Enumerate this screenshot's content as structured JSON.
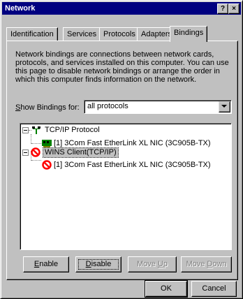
{
  "window": {
    "title": "Network",
    "help_label": "?",
    "close_label": "×"
  },
  "tabs": [
    {
      "label": "Identification"
    },
    {
      "label": "Services"
    },
    {
      "label": "Protocols"
    },
    {
      "label": "Adapters"
    },
    {
      "label": "Bindings"
    }
  ],
  "active_tab": "Bindings",
  "description": "Network bindings are connections between network cards, protocols, and services installed on this computer.  You can use this page to disable network bindings or arrange the order in which this computer finds information on the network.",
  "show_bindings": {
    "label": "Show Bindings for:",
    "value": "all protocols"
  },
  "tree": [
    {
      "label": "TCP/IP Protocol",
      "icon": "protocol-icon",
      "child": "[1] 3Com Fast EtherLink XL NIC (3C905B-TX)",
      "child_icon": "network-card-icon"
    },
    {
      "label": "WINS Client(TCP/IP)",
      "icon": "disabled-icon",
      "child": "[1] 3Com Fast EtherLink XL NIC (3C905B-TX)",
      "child_icon": "disabled-icon",
      "selected": true
    }
  ],
  "buttons": {
    "enable": "Enable",
    "disable": "Disable",
    "move_up": "Move Up",
    "move_down": "Move Down"
  },
  "footer": {
    "ok": "OK",
    "cancel": "Cancel"
  },
  "colors": {
    "titlebar": "#000080",
    "face": "#c0c0c0",
    "disabled_red": "#ff0000"
  }
}
